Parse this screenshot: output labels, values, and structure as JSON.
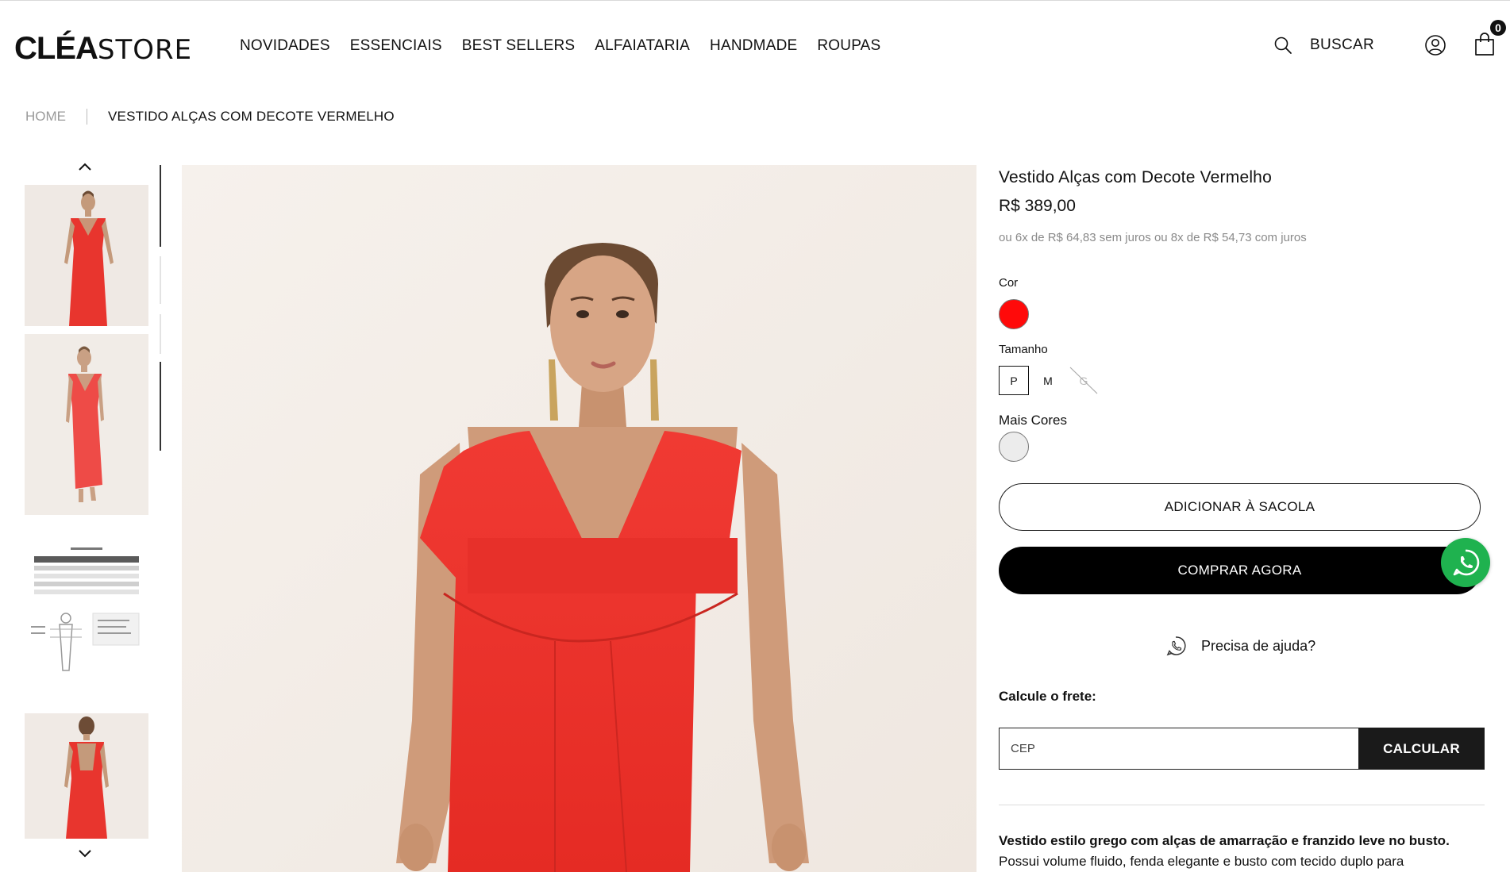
{
  "header": {
    "logo_bold": "CLÉA",
    "logo_light": "STORE",
    "nav": [
      "NOVIDADES",
      "ESSENCIAIS",
      "BEST SELLERS",
      "ALFAIATARIA",
      "HANDMADE",
      "ROUPAS"
    ],
    "search_label": "BUSCAR",
    "cart_count": "0"
  },
  "breadcrumb": {
    "home": "HOME",
    "current": "VESTIDO ALÇAS COM DECOTE VERMELHO"
  },
  "gallery": {
    "thumbnails": [
      "photo-front",
      "photo-side",
      "size-chart",
      "photo-back"
    ],
    "active_index": 0
  },
  "product": {
    "title": "Vestido Alças com Decote Vermelho",
    "price": "R$ 389,00",
    "installments": "ou 6x de R$ 64,83 sem juros ou 8x de R$ 54,73 com juros",
    "color_label": "Cor",
    "color_selected": "#ff0a0a",
    "size_label": "Tamanho",
    "sizes": [
      {
        "label": "P",
        "selected": true,
        "available": true
      },
      {
        "label": "M",
        "selected": false,
        "available": true
      },
      {
        "label": "G",
        "selected": false,
        "available": false
      }
    ],
    "more_colors_label": "Mais Cores",
    "more_colors": [
      "#ececec"
    ],
    "add_to_bag": "ADICIONAR À SACOLA",
    "buy_now": "COMPRAR AGORA",
    "help_label": "Precisa de ajuda?",
    "shipping_label": "Calcule o frete:",
    "cep_placeholder": "CEP",
    "calc_button": "CALCULAR",
    "description_bold": "Vestido estilo grego com alças de amarração e franzido leve no busto.",
    "description_text": "Possui volume fluido, fenda elegante e busto com tecido duplo para"
  },
  "colors": {
    "accent": "#000000",
    "whatsapp": "#1fb24f",
    "dress_red": "#ef2b2b"
  }
}
